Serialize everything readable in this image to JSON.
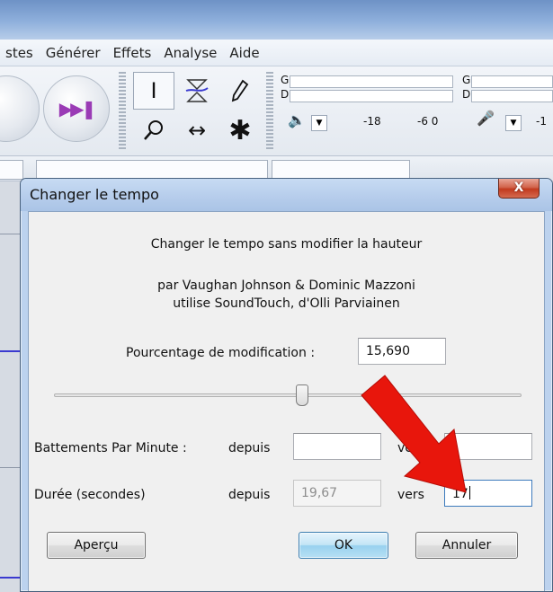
{
  "menubar": {
    "items": [
      "stes",
      "Générer",
      "Effets",
      "Analyse",
      "Aide"
    ]
  },
  "toolbar": {
    "transport_icon": "skip-to-end-icon",
    "tools": [
      "selection-tool-icon",
      "envelope-tool-icon",
      "draw-tool-icon",
      "zoom-tool-icon",
      "timeshift-tool-icon",
      "multi-tool-icon"
    ]
  },
  "meters": {
    "playback_label_g": "G",
    "playback_label_d": "D",
    "record_label_g": "G",
    "record_label_d": "D",
    "scale_1": "-18",
    "scale_2": "-6 0",
    "scale_3": "-1"
  },
  "dialog": {
    "title": "Changer le tempo",
    "close_label": "X",
    "description": "Changer le tempo sans modifier la hauteur",
    "authors": "par Vaughan Johnson & Dominic Mazzoni",
    "library": "utilise SoundTouch, d'Olli Parviainen",
    "percent_label": "Pourcentage de modification :",
    "percent_value": "15,690",
    "slider_level": 0.53,
    "bpm": {
      "label": "Battements Par Minute :",
      "from_label": "depuis",
      "from_value": "",
      "to_label": "vers",
      "to_value": ""
    },
    "duration": {
      "label": "Durée (secondes)",
      "from_label": "depuis",
      "from_value": "19,67",
      "to_label": "vers",
      "to_value": "17"
    },
    "buttons": {
      "preview": "Aperçu",
      "ok": "OK",
      "cancel": "Annuler"
    }
  },
  "annotation": {
    "arrow_color": "#e8160c",
    "arrow_icon": "red-arrow-icon"
  },
  "colors": {
    "dialog_frame": "#bcd2ee",
    "default_button": "#98d1ef"
  }
}
